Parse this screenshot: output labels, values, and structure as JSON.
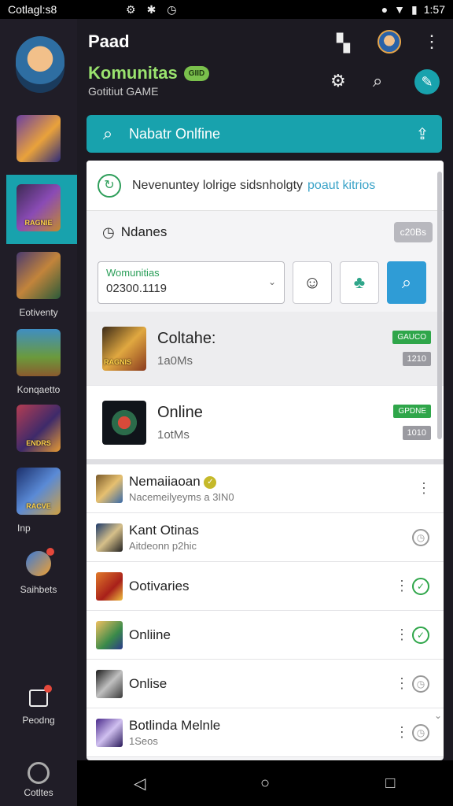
{
  "status_bar": {
    "carrier": "Cotlagl:s8",
    "time": "1:57",
    "icons": [
      "settings-icon",
      "signal-icon",
      "clock-icon",
      "wifi-icon",
      "battery-icon"
    ]
  },
  "sidebar": {
    "items": [
      {
        "caption": "",
        "label": ""
      },
      {
        "caption": "RAGNIE",
        "label": ""
      },
      {
        "caption": "",
        "label": "Eotiventy"
      },
      {
        "caption": "",
        "label": "Konqaetto"
      },
      {
        "caption": "ENDRS",
        "label": ""
      },
      {
        "caption": "RACVE",
        "label": "Inp"
      }
    ],
    "chat_label": "Saihbets",
    "box_label": "Peodng",
    "bottom_label": "Cotltes"
  },
  "header": {
    "title": "Paad",
    "community": "Komunitas",
    "badge": "GIID",
    "subtitle": "Gotitiut GAME"
  },
  "search": {
    "placeholder": "Nabatr Onlfine"
  },
  "banner": {
    "text": "Nevenuntey lolrige sidsnholgty",
    "link": "poaut kitrios"
  },
  "section": {
    "title": "Ndanes",
    "chip": "c20Bs"
  },
  "filter": {
    "label": "Womunitias",
    "value": "02300.1119"
  },
  "games": [
    {
      "title": "Coltahe:",
      "sub": "1a0Ms",
      "tag": "GAUCO",
      "count": "1210",
      "caption": "RAGNIS"
    },
    {
      "title": "Online",
      "sub": "1otMs",
      "tag": "GPDNE",
      "count": "1010",
      "caption": ""
    }
  ],
  "list": [
    {
      "title": "Nemaiiaoan",
      "sub": "Nacemeilyeyms a 3IN0",
      "status": "more"
    },
    {
      "title": "Kant Otinas",
      "sub": "Aitdeonn p2hic",
      "status": "clock"
    },
    {
      "title": "Ootivaries",
      "sub": "",
      "status": "check"
    },
    {
      "title": "Onliine",
      "sub": "",
      "status": "check"
    },
    {
      "title": "Onlise",
      "sub": "",
      "status": "clock"
    },
    {
      "title": "Botlinda Melnle",
      "sub": "1Seos",
      "status": "clock"
    }
  ],
  "colors": {
    "accent": "#18a2ad",
    "community_green": "#9ae36e",
    "tag_green": "#2fa64a",
    "action_blue": "#2f9cd6"
  }
}
